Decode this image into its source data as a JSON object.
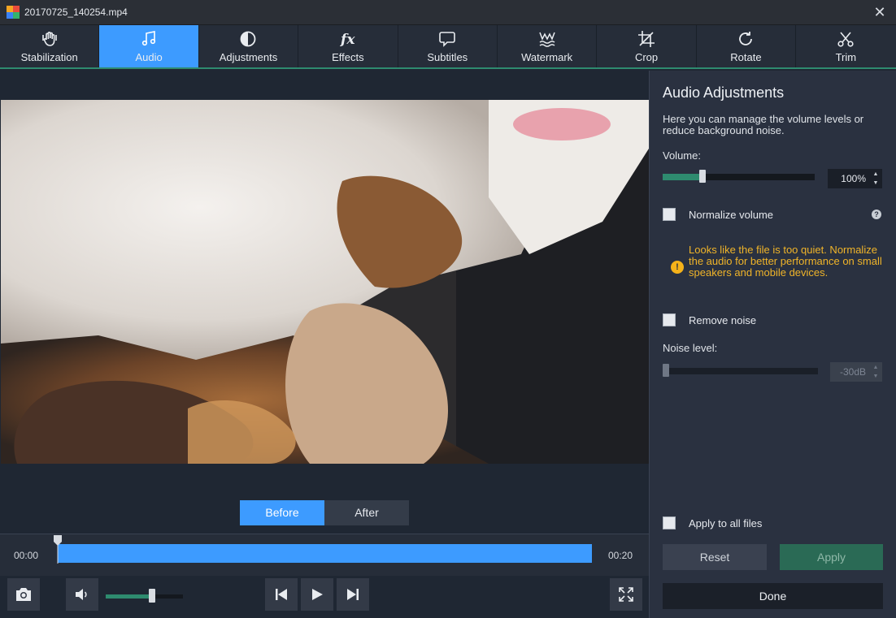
{
  "window": {
    "title": "20170725_140254.mp4",
    "close_glyph": "✕"
  },
  "tabs": [
    {
      "label": "Stabilization",
      "icon": "stabilization-hand-icon",
      "active": false
    },
    {
      "label": "Audio",
      "icon": "music-note-icon",
      "active": true
    },
    {
      "label": "Adjustments",
      "icon": "contrast-icon",
      "active": false
    },
    {
      "label": "Effects",
      "icon": "fx-icon",
      "active": false
    },
    {
      "label": "Subtitles",
      "icon": "speech-bubble-icon",
      "active": false
    },
    {
      "label": "Watermark",
      "icon": "watermark-icon",
      "active": false
    },
    {
      "label": "Crop",
      "icon": "crop-icon",
      "active": false
    },
    {
      "label": "Rotate",
      "icon": "rotate-icon",
      "active": false
    },
    {
      "label": "Trim",
      "icon": "scissors-icon",
      "active": false
    }
  ],
  "preview": {
    "before_label": "Before",
    "after_label": "After",
    "selected": "Before"
  },
  "timeline": {
    "start_time": "00:00",
    "end_time": "00:20",
    "position": 0.0
  },
  "controls": {
    "snapshot_icon": "camera-icon",
    "volume_icon": "speaker-icon",
    "player_volume": 0.6,
    "prev_icon": "skip-previous-icon",
    "play_icon": "play-icon",
    "next_icon": "skip-next-icon",
    "fullscreen_icon": "fullscreen-icon"
  },
  "panel": {
    "title": "Audio Adjustments",
    "description": "Here you can manage the volume levels or reduce background noise.",
    "volume_label": "Volume:",
    "volume_value": "100%",
    "volume_level": 0.26,
    "normalize_label": "Normalize volume",
    "normalize_checked": false,
    "warning_text": "Looks like the file is too quiet. Normalize the audio for better performance on small speakers and mobile devices.",
    "remove_noise_label": "Remove noise",
    "remove_noise_checked": false,
    "noise_label": "Noise level:",
    "noise_value": "-30dB",
    "noise_level": 0.0,
    "apply_all_label": "Apply to all files",
    "apply_all_checked": false,
    "reset_label": "Reset",
    "apply_label": "Apply",
    "done_label": "Done"
  },
  "colors": {
    "accent_blue": "#3d9bff",
    "accent_green": "#2e8b6f",
    "warning": "#f0b429",
    "background": "#1f2733",
    "panel": "#2a3140"
  }
}
